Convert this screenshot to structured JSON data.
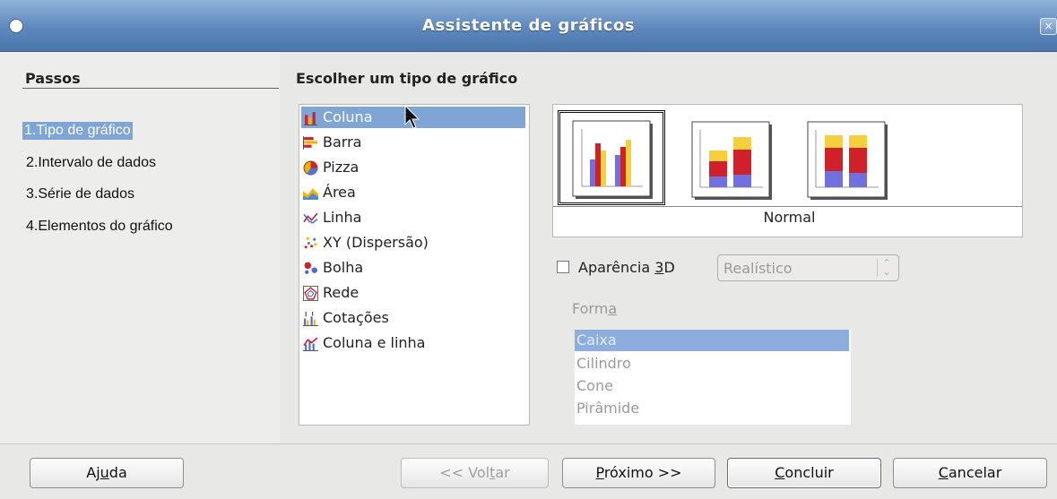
{
  "window": {
    "title": "Assistente de gráficos",
    "close_glyph": "×"
  },
  "steps": {
    "title": "Passos",
    "items": [
      {
        "num": "1.",
        "label": "Tipo de gráfico"
      },
      {
        "num": "2.",
        "label": "Intervalo de dados"
      },
      {
        "num": "3.",
        "label": "Série de dados"
      },
      {
        "num": "4.",
        "label": "Elementos do gráfico"
      }
    ],
    "active_index": 0
  },
  "main": {
    "heading": "Escolher um tipo de gráfico",
    "chart_types": [
      {
        "label": "Coluna",
        "icon": "column-chart-icon"
      },
      {
        "label": "Barra",
        "icon": "bar-chart-icon"
      },
      {
        "label": "Pizza",
        "icon": "pie-chart-icon"
      },
      {
        "label": "Área",
        "icon": "area-chart-icon"
      },
      {
        "label": "Linha",
        "icon": "line-chart-icon"
      },
      {
        "label": "XY (Dispersão)",
        "icon": "scatter-chart-icon"
      },
      {
        "label": "Bolha",
        "icon": "bubble-chart-icon"
      },
      {
        "label": "Rede",
        "icon": "net-chart-icon"
      },
      {
        "label": "Cotações",
        "icon": "stock-chart-icon"
      },
      {
        "label": "Coluna e linha",
        "icon": "column-line-chart-icon"
      }
    ],
    "selected_type_index": 0,
    "variants": [
      {
        "icon": "normal-column-variant-icon"
      },
      {
        "icon": "stacked-column-variant-icon"
      },
      {
        "icon": "percent-stacked-column-variant-icon"
      }
    ],
    "selected_variant_index": 0,
    "variant_name": "Normal",
    "appearance_3d": {
      "label_before": "Aparência ",
      "label_key": "3",
      "label_after": "D",
      "checked": false
    },
    "appearance_combo": {
      "value": "Realístico"
    },
    "shape": {
      "label_before": "Form",
      "label_key": "a",
      "label_after": "",
      "options": [
        "Caixa",
        "Cilindro",
        "Cone",
        "Pirâmide"
      ],
      "selected_index": 0
    }
  },
  "footer": {
    "help": {
      "before": "Aj",
      "key": "u",
      "after": "da"
    },
    "back": {
      "before": "<< Vol",
      "key": "t",
      "after": "ar"
    },
    "next": {
      "before": "",
      "key": "P",
      "after": "róximo >>"
    },
    "finish": {
      "before": "",
      "key": "C",
      "after": "oncluir"
    },
    "cancel": {
      "before": "",
      "key": "C",
      "after": "ancelar"
    }
  },
  "colors": {
    "accent": "#7fa5d7",
    "chart_blue": "#7070e0",
    "chart_red": "#d0202a",
    "chart_yellow": "#f5d03c"
  }
}
